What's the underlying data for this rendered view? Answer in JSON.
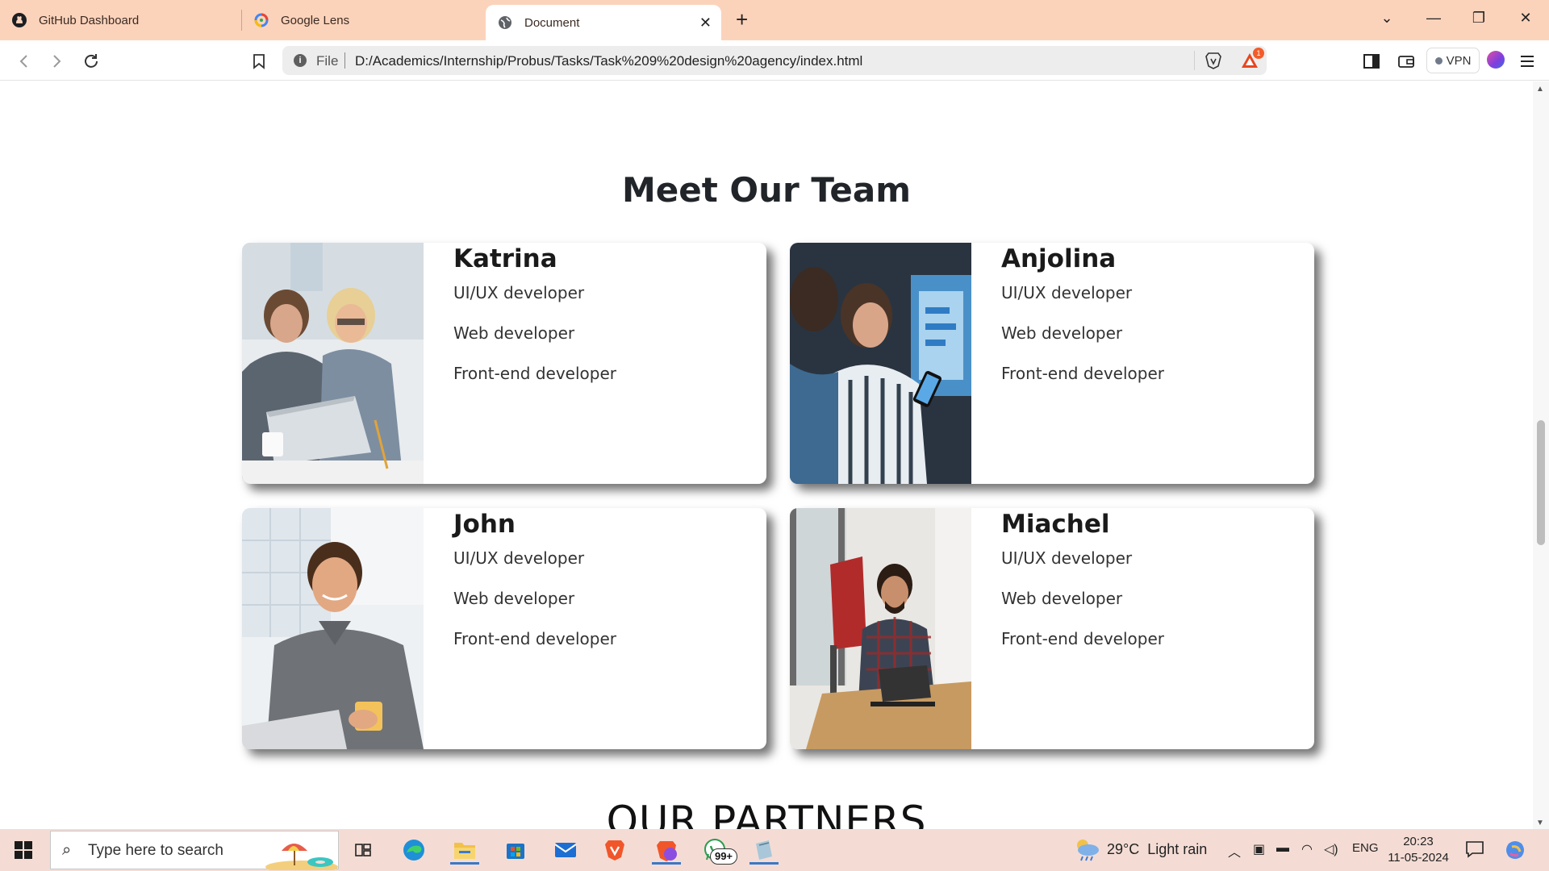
{
  "browser": {
    "tabs": [
      {
        "title": "GitHub Dashboard",
        "icon": "github-icon"
      },
      {
        "title": "Google Lens",
        "icon": "google-lens-icon"
      },
      {
        "title": "Document",
        "icon": "globe-icon",
        "active": true
      }
    ],
    "address": {
      "scheme_label": "File",
      "url": "D:/Academics/Internship/Probus/Tasks/Task%209%20design%20agency/index.html"
    },
    "rewards_badge": "1",
    "vpn_label": "VPN",
    "accent_color": "#fbd3bb"
  },
  "page": {
    "team_heading": "Meet Our Team",
    "members": [
      {
        "name": "Katrina",
        "roles": [
          "UI/UX developer",
          "Web developer",
          "Front-end developer"
        ]
      },
      {
        "name": "Anjolina",
        "roles": [
          "UI/UX developer",
          "Web developer",
          "Front-end developer"
        ]
      },
      {
        "name": "John",
        "roles": [
          "UI/UX developer",
          "Web developer",
          "Front-end developer"
        ]
      },
      {
        "name": "Miachel",
        "roles": [
          "UI/UX developer",
          "Web developer",
          "Front-end developer"
        ]
      }
    ],
    "partners_heading": "OUR PARTNERS"
  },
  "taskbar": {
    "search_placeholder": "Type here to search",
    "whatsapp_badge": "99+",
    "weather": {
      "temp": "29°C",
      "condition": "Light rain"
    },
    "language": "ENG",
    "time": "20:23",
    "date": "11-05-2024"
  }
}
